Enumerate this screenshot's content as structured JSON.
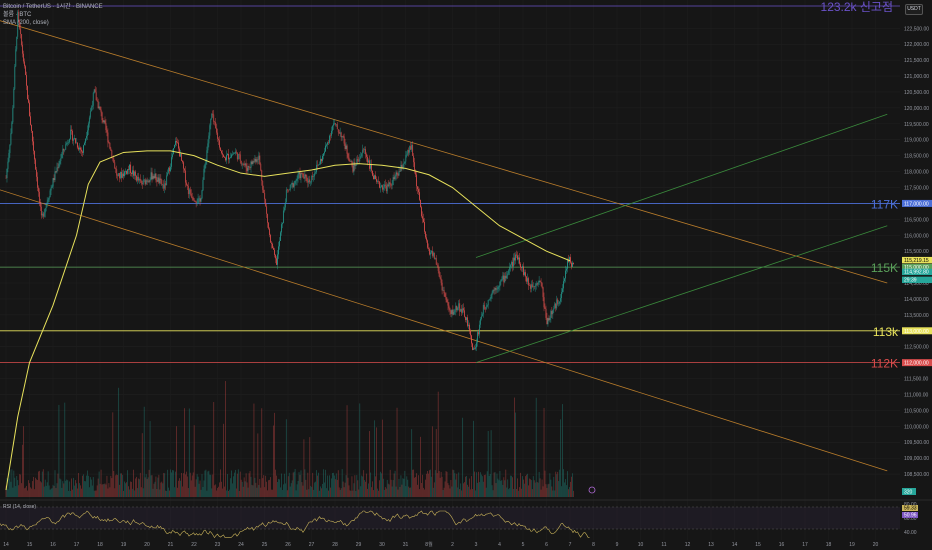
{
  "header": {
    "title": "Bitcoin / TetherUS · 1시간 · BINANCE",
    "volume_label": "볼륨 · BTC",
    "sma_label": "SMA (200, close)",
    "currency": "USDT"
  },
  "colors": {
    "background": "#161616",
    "up": "#26a69a",
    "down": "#ef5350",
    "sma": "#e8e25c",
    "channel": "#b87c2b",
    "green_channel": "#3a8a3c",
    "blue_level": "#4c6fd8",
    "green_level": "#5aa05a",
    "yellow_level": "#e8e25c",
    "red_level": "#d94c4c",
    "ath_level": "#6a52c8",
    "rsi": "#c9b35a"
  },
  "chart_data": {
    "type": "candlestick",
    "ylim": [
      108000,
      123200
    ],
    "y_ticks": [
      "122,500.00",
      "122,000.00",
      "121,500.00",
      "121,000.00",
      "120,500.00",
      "120,000.00",
      "119,500.00",
      "119,000.00",
      "118,500.00",
      "118,000.00",
      "117,500.00",
      "117,000.00",
      "116,500.00",
      "116,000.00",
      "115,500.00",
      "115,000.00",
      "114,500.00",
      "114,000.00",
      "113,500.00",
      "113,000.00",
      "112,500.00",
      "112,000.00",
      "111,500.00",
      "111,000.00",
      "110,500.00",
      "110,000.00",
      "109,500.00",
      "109,000.00",
      "108,500.00"
    ],
    "x_ticks": [
      "14",
      "15",
      "16",
      "17",
      "18",
      "19",
      "20",
      "21",
      "22",
      "23",
      "24",
      "25",
      "26",
      "27",
      "28",
      "29",
      "30",
      "31",
      "8월",
      "2",
      "3",
      "4",
      "5",
      "6",
      "7",
      "8",
      "9",
      "10",
      "11",
      "12",
      "13",
      "14",
      "15",
      "16",
      "17",
      "18",
      "19",
      "20"
    ],
    "close_path": [
      {
        "x": "07-14 00:00",
        "c": 117800
      },
      {
        "x": "07-14 06:00",
        "c": 119500
      },
      {
        "x": "07-14 12:00",
        "c": 122900
      },
      {
        "x": "07-14 18:00",
        "c": 121500
      },
      {
        "x": "07-15 00:00",
        "c": 119800
      },
      {
        "x": "07-15 12:00",
        "c": 116500
      },
      {
        "x": "07-15 20:00",
        "c": 117300
      },
      {
        "x": "07-16 06:00",
        "c": 118300
      },
      {
        "x": "07-16 18:00",
        "c": 119200
      },
      {
        "x": "07-17 06:00",
        "c": 118600
      },
      {
        "x": "07-17 18:00",
        "c": 120500
      },
      {
        "x": "07-18 06:00",
        "c": 119300
      },
      {
        "x": "07-18 18:00",
        "c": 117800
      },
      {
        "x": "07-19 06:00",
        "c": 118100
      },
      {
        "x": "07-19 18:00",
        "c": 117600
      },
      {
        "x": "07-20 06:00",
        "c": 117900
      },
      {
        "x": "07-20 18:00",
        "c": 117500
      },
      {
        "x": "07-21 06:00",
        "c": 119000
      },
      {
        "x": "07-21 18:00",
        "c": 117400
      },
      {
        "x": "07-22 06:00",
        "c": 117000
      },
      {
        "x": "07-22 18:00",
        "c": 119800
      },
      {
        "x": "07-23 06:00",
        "c": 118400
      },
      {
        "x": "07-23 18:00",
        "c": 118600
      },
      {
        "x": "07-24 06:00",
        "c": 118100
      },
      {
        "x": "07-24 18:00",
        "c": 118500
      },
      {
        "x": "07-25 06:00",
        "c": 115800
      },
      {
        "x": "07-25 12:00",
        "c": 115100
      },
      {
        "x": "07-25 22:00",
        "c": 117300
      },
      {
        "x": "07-26 12:00",
        "c": 117900
      },
      {
        "x": "07-26 22:00",
        "c": 117700
      },
      {
        "x": "07-27 12:00",
        "c": 118500
      },
      {
        "x": "07-27 22:00",
        "c": 119500
      },
      {
        "x": "07-28 06:00",
        "c": 119200
      },
      {
        "x": "07-28 18:00",
        "c": 118100
      },
      {
        "x": "07-29 06:00",
        "c": 118700
      },
      {
        "x": "07-29 18:00",
        "c": 117600
      },
      {
        "x": "07-30 06:00",
        "c": 117500
      },
      {
        "x": "07-30 18:00",
        "c": 118000
      },
      {
        "x": "07-31 06:00",
        "c": 118800
      },
      {
        "x": "07-31 12:00",
        "c": 117500
      },
      {
        "x": "07-31 22:00",
        "c": 115600
      },
      {
        "x": "08-01 06:00",
        "c": 115300
      },
      {
        "x": "08-01 14:00",
        "c": 114300
      },
      {
        "x": "08-01 22:00",
        "c": 113500
      },
      {
        "x": "08-02 06:00",
        "c": 113800
      },
      {
        "x": "08-02 14:00",
        "c": 113400
      },
      {
        "x": "08-02 22:00",
        "c": 112300
      },
      {
        "x": "08-03 06:00",
        "c": 113600
      },
      {
        "x": "08-03 18:00",
        "c": 114300
      },
      {
        "x": "08-04 06:00",
        "c": 114700
      },
      {
        "x": "08-04 18:00",
        "c": 115400
      },
      {
        "x": "08-05 06:00",
        "c": 114400
      },
      {
        "x": "08-05 18:00",
        "c": 114600
      },
      {
        "x": "08-06 00:00",
        "c": 113300
      },
      {
        "x": "08-06 08:00",
        "c": 113700
      },
      {
        "x": "08-06 16:00",
        "c": 114200
      },
      {
        "x": "08-06 22:00",
        "c": 115300
      },
      {
        "x": "08-07 04:00",
        "c": 114990
      }
    ],
    "sma": [
      {
        "x": "07-14 00:00",
        "v": 108000
      },
      {
        "x": "07-14 12:00",
        "v": 110300
      },
      {
        "x": "07-15 00:00",
        "v": 112000
      },
      {
        "x": "07-16 00:00",
        "v": 113800
      },
      {
        "x": "07-17 00:00",
        "v": 116000
      },
      {
        "x": "07-17 12:00",
        "v": 117600
      },
      {
        "x": "07-18 00:00",
        "v": 118300
      },
      {
        "x": "07-19 00:00",
        "v": 118600
      },
      {
        "x": "07-20 00:00",
        "v": 118650
      },
      {
        "x": "07-21 00:00",
        "v": 118650
      },
      {
        "x": "07-22 00:00",
        "v": 118500
      },
      {
        "x": "07-23 00:00",
        "v": 118200
      },
      {
        "x": "07-24 00:00",
        "v": 117950
      },
      {
        "x": "07-25 00:00",
        "v": 117850
      },
      {
        "x": "07-26 00:00",
        "v": 117950
      },
      {
        "x": "07-27 00:00",
        "v": 118050
      },
      {
        "x": "07-28 00:00",
        "v": 118200
      },
      {
        "x": "07-29 00:00",
        "v": 118250
      },
      {
        "x": "07-30 00:00",
        "v": 118200
      },
      {
        "x": "07-31 00:00",
        "v": 118100
      },
      {
        "x": "08-01 00:00",
        "v": 117900
      },
      {
        "x": "08-02 00:00",
        "v": 117500
      },
      {
        "x": "08-03 00:00",
        "v": 116900
      },
      {
        "x": "08-04 00:00",
        "v": 116300
      },
      {
        "x": "08-05 00:00",
        "v": 115900
      },
      {
        "x": "08-06 00:00",
        "v": 115500
      },
      {
        "x": "08-07 00:00",
        "v": 115200
      }
    ],
    "horizontal_levels": [
      {
        "label": "123.2k 신고점",
        "price": 123200,
        "tag": "",
        "color_key": "ath_level"
      },
      {
        "label": "117K",
        "price": 117000,
        "tag": "117,000.00",
        "color_key": "blue_level"
      },
      {
        "label": "115K",
        "price": 115000,
        "tag": "",
        "color_key": "green_level"
      },
      {
        "label": "113k",
        "price": 113000,
        "tag": "113,000.00",
        "color_key": "yellow_level"
      },
      {
        "label": "112K",
        "price": 112000,
        "tag": "112,000.00",
        "color_key": "red_level"
      }
    ],
    "trend_lines": [
      {
        "color_key": "channel",
        "from": [
          "07-13 00:00",
          122900
        ],
        "to": [
          "08-20 12:00",
          114500
        ]
      },
      {
        "color_key": "channel",
        "from": [
          "07-13 00:00",
          117600
        ],
        "to": [
          "08-20 12:00",
          108600
        ]
      },
      {
        "color_key": "green_channel",
        "from": [
          "08-03 00:00",
          115300
        ],
        "to": [
          "08-20 12:00",
          119800
        ]
      },
      {
        "color_key": "green_channel",
        "from": [
          "08-03 00:00",
          112000
        ],
        "to": [
          "08-20 12:00",
          116300
        ]
      }
    ],
    "price_tags": [
      {
        "text": "115,219.15",
        "color_key": "yellow_level",
        "price": 115219
      },
      {
        "text": "115,000.00",
        "color_key": "green_level",
        "price": 115000
      },
      {
        "text": "114,992.80",
        "color_key": "up",
        "price": 114850
      },
      {
        "text": "29:39",
        "color_key": "up",
        "price": 114600
      }
    ],
    "volume_tag": "320",
    "rsi": {
      "label": "RSI (14, close)",
      "value": "59.33",
      "sma_value": "50.96",
      "ticks": [
        "80.00",
        "60.00",
        "40.00"
      ],
      "color_key": "rsi"
    }
  }
}
